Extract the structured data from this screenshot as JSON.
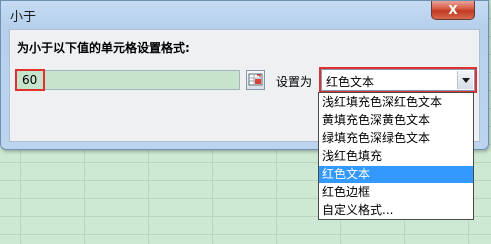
{
  "dialog": {
    "title": "小于",
    "close_label": "X",
    "prompt": "为小于以下值的单元格设置格式:",
    "value": "60",
    "set_label": "设置为",
    "selected_format": "红色文本"
  },
  "dropdown": {
    "options": [
      "浅红填充色深红色文本",
      "黄填充色深黄色文本",
      "绿填充色深绿色文本",
      "浅红色填充",
      "红色文本",
      "红色边框",
      "自定义格式..."
    ],
    "selected_index": 4
  },
  "colors": {
    "highlight": "#e03030",
    "selection": "#3399ff",
    "input_background": "#c6e3cb"
  },
  "icons": {
    "range_picker": "collapse-dialog-icon",
    "dropdown": "chevron-down-icon",
    "close": "close-icon"
  }
}
